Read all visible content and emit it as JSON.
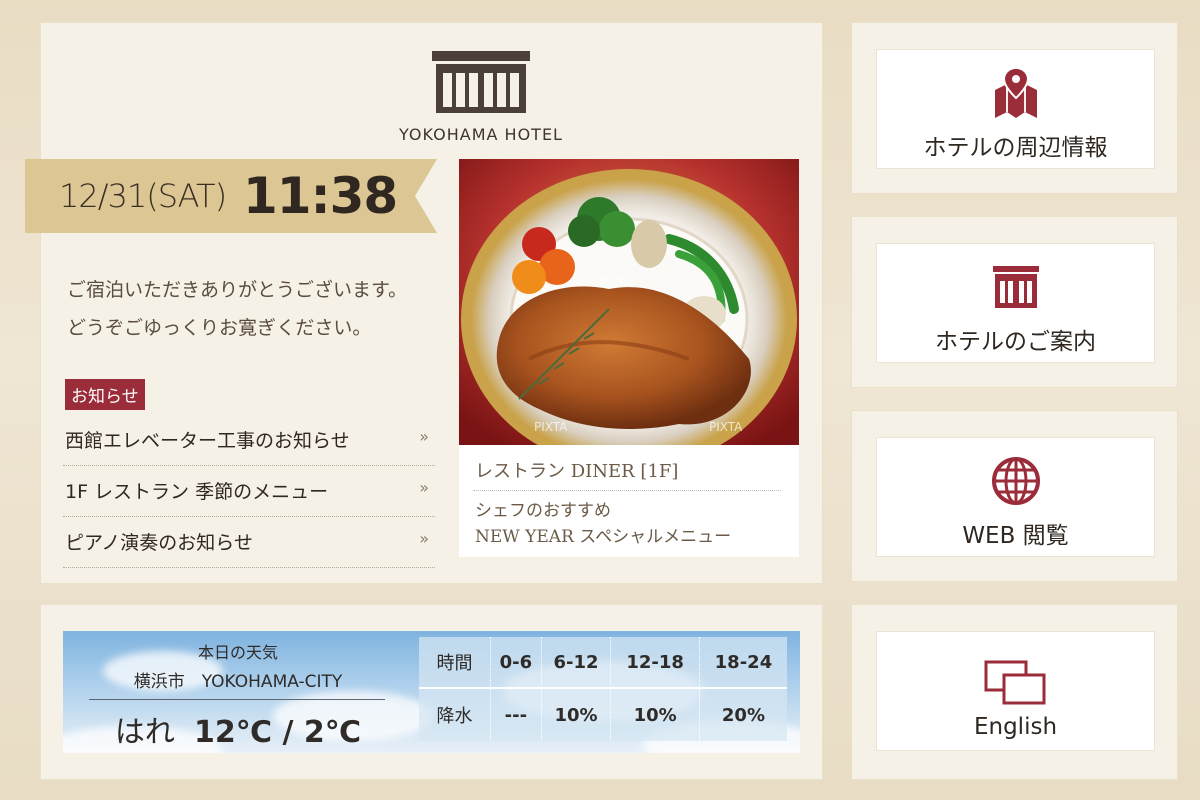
{
  "hotel": {
    "name": "YOKOHAMA HOTEL"
  },
  "clock": {
    "date": "12/31(SAT)",
    "time": "11:38"
  },
  "welcome": {
    "line1": "ご宿泊いただきありがとうございます。",
    "line2": "どうぞごゆっくりお寛ぎください。"
  },
  "notices": {
    "badge": "お知らせ",
    "arrow": "»",
    "items": [
      {
        "label": "西館エレベーター工事のお知らせ"
      },
      {
        "label": "1F レストラン 季節のメニュー"
      },
      {
        "label": "ピアノ演奏のお知らせ"
      }
    ]
  },
  "restaurant": {
    "title": "レストラン DINER [1F]",
    "sub1": "シェフのおすすめ",
    "sub2": "NEW YEAR スペシャルメニュー",
    "watermark": "PIXTA"
  },
  "side": {
    "area": {
      "label": "ホテルの周辺情報",
      "icon": "map-pin-icon"
    },
    "guide": {
      "label": "ホテルのご案内",
      "icon": "hotel-icon"
    },
    "web": {
      "label": "WEB 閲覧",
      "icon": "globe-icon"
    },
    "english": {
      "label": "English",
      "icon": "language-windows-icon"
    }
  },
  "weather": {
    "heading": "本日の天気",
    "city": "横浜市　YOKOHAMA-CITY",
    "condition": "はれ",
    "temps": "12℃ / 2℃",
    "table": {
      "row1_header": "時間",
      "row2_header": "降水",
      "slots": [
        "0-6",
        "6-12",
        "12-18",
        "18-24"
      ],
      "precip": [
        "---",
        "10%",
        "10%",
        "20%"
      ]
    }
  },
  "colors": {
    "accent": "#9b2c3a",
    "ribbon": "#dcc694",
    "ribbon_dark": "#a48a55",
    "logo": "#4a4037"
  }
}
